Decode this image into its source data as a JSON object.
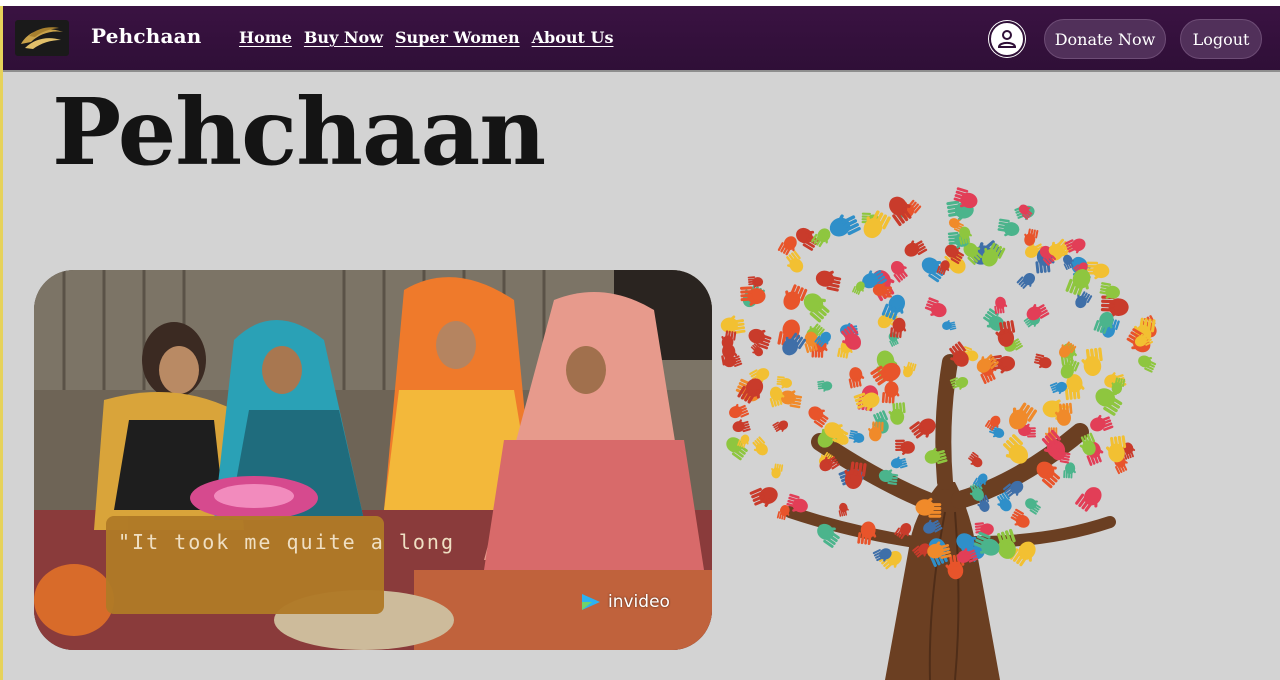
{
  "header": {
    "brand": "Pehchaan",
    "nav": [
      {
        "label": "Home"
      },
      {
        "label": "Buy Now"
      },
      {
        "label": "Super Women"
      },
      {
        "label": "About Us"
      }
    ],
    "user_icon": "user-icon",
    "donate_label": "Donate Now",
    "logout_label": "Logout"
  },
  "hero": {
    "title": "Pehchaan"
  },
  "video": {
    "caption": "\"It took me quite a long",
    "watermark": "invideo"
  },
  "colors": {
    "nav_bg": "#2f0f37",
    "pill_bg": "#51305a",
    "page_bg": "#d3d3d3",
    "caption_bg": "#b07a27"
  }
}
